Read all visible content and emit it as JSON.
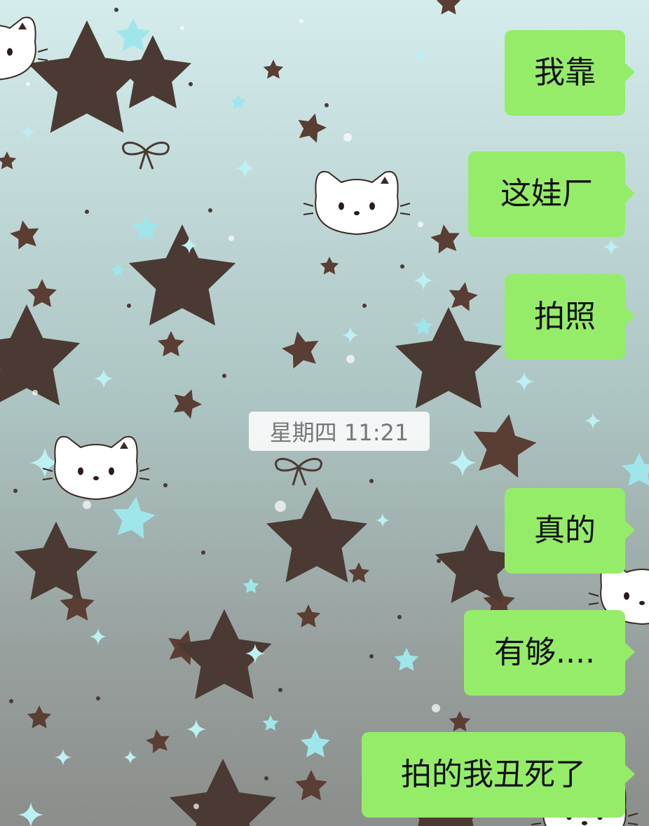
{
  "chat": {
    "timestamp": "星期四 11:21",
    "messages": [
      {
        "text": "我靠",
        "side": "right"
      },
      {
        "text": "这娃厂",
        "side": "right"
      },
      {
        "text": "拍照",
        "side": "right"
      },
      {
        "text": "真的",
        "side": "right"
      },
      {
        "text": "有够....",
        "side": "right"
      },
      {
        "text": "拍的我丑死了",
        "side": "right"
      }
    ]
  },
  "colors": {
    "bubble": "#95ec69",
    "bubble_text": "#111111",
    "timestamp_text": "#777777",
    "wallpaper_top": "#d4ecec",
    "wallpaper_bottom": "#8b8e8b"
  },
  "icons": [
    "kitty-face-icon",
    "star-icon",
    "sparkle-icon",
    "bow-icon"
  ]
}
